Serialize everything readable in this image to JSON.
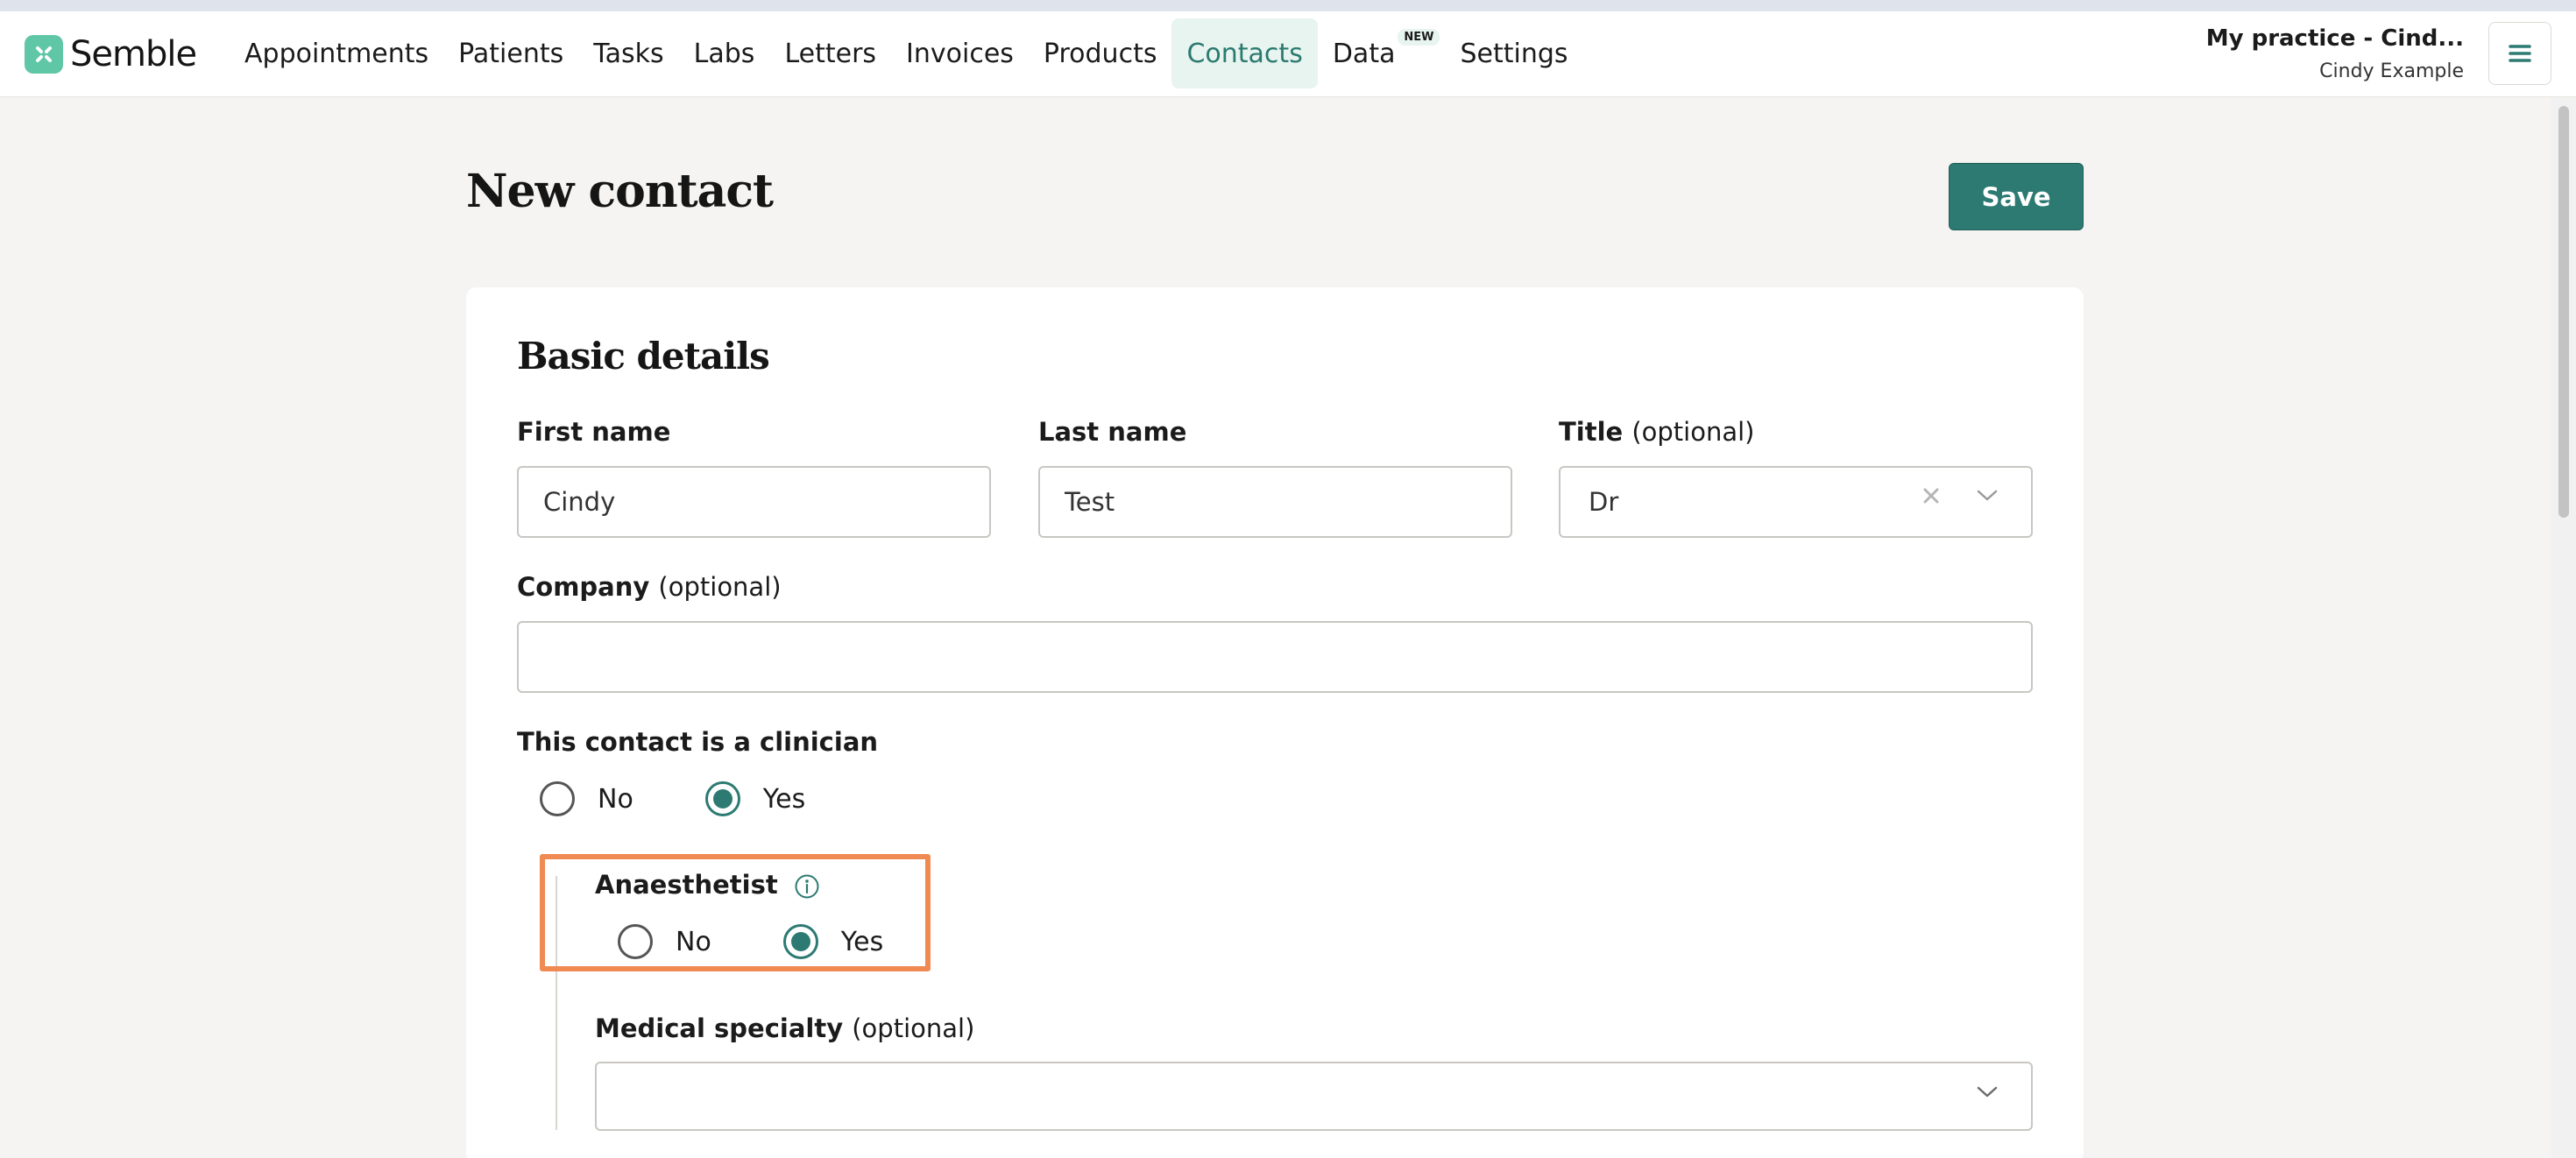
{
  "brand": {
    "name": "Semble",
    "logo_color": "#5fc6a6"
  },
  "nav": {
    "items": [
      {
        "label": "Appointments"
      },
      {
        "label": "Patients"
      },
      {
        "label": "Tasks"
      },
      {
        "label": "Labs"
      },
      {
        "label": "Letters"
      },
      {
        "label": "Invoices"
      },
      {
        "label": "Products"
      },
      {
        "label": "Contacts",
        "active": true
      },
      {
        "label": "Data",
        "badge": "NEW"
      },
      {
        "label": "Settings"
      }
    ]
  },
  "account": {
    "practice": "My practice - Cind...",
    "user": "Cindy Example",
    "menu_icon": "hamburger-menu-icon"
  },
  "page": {
    "title": "New contact",
    "save_label": "Save",
    "accent_color": "#2c7a72",
    "highlight_color": "#ef8a53"
  },
  "basic_details": {
    "title": "Basic details",
    "first_name": {
      "label": "First name",
      "value": "Cindy"
    },
    "last_name": {
      "label": "Last name",
      "value": "Test"
    },
    "title_field": {
      "label": "Title",
      "optional": "(optional)",
      "value": "Dr",
      "clear_icon": "clear-x-icon",
      "dropdown_icon": "chevron-down-icon"
    },
    "company": {
      "label": "Company",
      "optional": "(optional)",
      "value": ""
    },
    "clinician": {
      "label": "This contact is a clinician",
      "options": [
        "No",
        "Yes"
      ],
      "selected": "Yes"
    },
    "anaesthetist": {
      "label": "Anaesthetist",
      "info_icon": "info-icon",
      "options": [
        "No",
        "Yes"
      ],
      "selected": "Yes"
    },
    "medical_specialty": {
      "label": "Medical specialty",
      "optional": "(optional)",
      "value": "",
      "dropdown_icon": "chevron-down-icon"
    }
  }
}
